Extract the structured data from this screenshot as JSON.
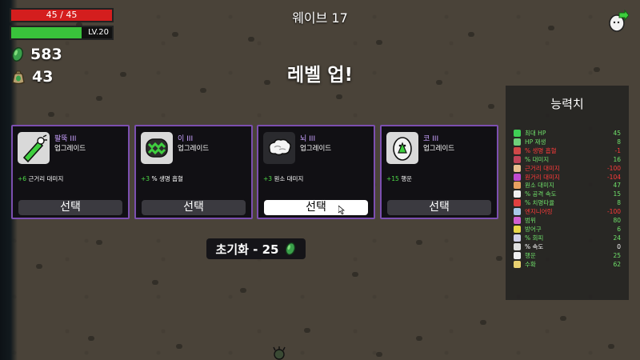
{
  "hud": {
    "hp": {
      "text": "45 / 45",
      "fraction": 1.0
    },
    "xp": {
      "level_text": "LV.20",
      "fraction": 0.7
    },
    "materials": {
      "icon": "green-material-icon",
      "value": "583"
    },
    "bag": {
      "icon": "material-bag-icon",
      "value": "43"
    },
    "wave": "웨이브 17",
    "character_icon": "potato-character-icon"
  },
  "title": "레벨 업!",
  "cards": [
    {
      "name": "팔뚝 III",
      "type": "업그레이드",
      "effect_num": "+6",
      "effect_text": " 근거리 대미지",
      "button": "선택",
      "active": false,
      "icon": "forearm-icon"
    },
    {
      "name": "이 III",
      "type": "업그레이드",
      "effect_num": "+3",
      "effect_text": " % 생명 흡혈",
      "button": "선택",
      "active": false,
      "icon": "teeth-icon"
    },
    {
      "name": "뇌 III",
      "type": "업그레이드",
      "effect_num": "+3",
      "effect_text": " 원소 대미지",
      "button": "선택",
      "active": true,
      "icon": "brain-icon"
    },
    {
      "name": "코 III",
      "type": "업그레이드",
      "effect_num": "+15",
      "effect_text": " 행운",
      "button": "선택",
      "active": false,
      "icon": "nose-icon"
    }
  ],
  "reroll": {
    "label": "초기화 - 25",
    "icon": "green-material-icon"
  },
  "stats": {
    "title": "능력치",
    "rows": [
      {
        "label": "최대 HP",
        "value": "45",
        "color": "#6fe06a",
        "icon_color": "#3fcf55"
      },
      {
        "label": "HP 재생",
        "value": "8",
        "color": "#6fe06a",
        "icon_color": "#6fd07a"
      },
      {
        "label": "% 생명 흡혈",
        "value": "-1",
        "color": "#ff3a3a",
        "icon_color": "#d04848"
      },
      {
        "label": "% 대미지",
        "value": "16",
        "color": "#6fe06a",
        "icon_color": "#c0455a"
      },
      {
        "label": "근거리 대미지",
        "value": "-100",
        "color": "#ff3a3a",
        "icon_color": "#e8c090"
      },
      {
        "label": "원거리 대미지",
        "value": "-104",
        "color": "#ff3a3a",
        "icon_color": "#c04ad0"
      },
      {
        "label": "원소 대미지",
        "value": "47",
        "color": "#6fe06a",
        "icon_color": "#e8a060"
      },
      {
        "label": "% 공격 속도",
        "value": "15",
        "color": "#6fe06a",
        "icon_color": "#f0f0f0"
      },
      {
        "label": "% 치명타율",
        "value": "8",
        "color": "#6fe06a",
        "icon_color": "#e04040"
      },
      {
        "label": "엔지니어링",
        "value": "-100",
        "color": "#ff3a3a",
        "icon_color": "#a8c8e8"
      },
      {
        "label": "범위",
        "value": "80",
        "color": "#6fe06a",
        "icon_color": "#d060d0"
      },
      {
        "label": "방어구",
        "value": "6",
        "color": "#6fe06a",
        "icon_color": "#e8d84a"
      },
      {
        "label": "% 회피",
        "value": "24",
        "color": "#6fe06a",
        "icon_color": "#d0d0e8"
      },
      {
        "label": "% 속도",
        "value": "0",
        "color": "#ffffff",
        "icon_color": "#e0e0e0"
      },
      {
        "label": "행운",
        "value": "25",
        "color": "#6fe06a",
        "icon_color": "#f0f0f0"
      },
      {
        "label": "수확",
        "value": "62",
        "color": "#6fe06a",
        "icon_color": "#e8d070"
      }
    ]
  }
}
